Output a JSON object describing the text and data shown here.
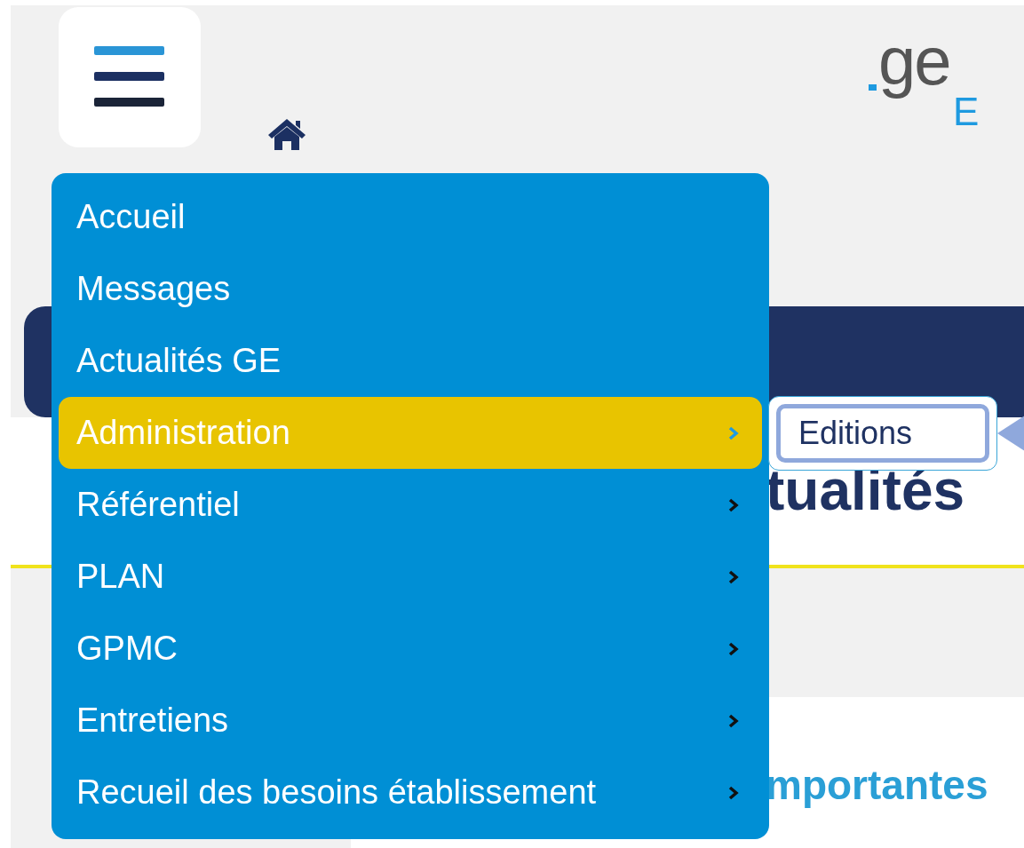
{
  "header": {
    "logo_text": "ge",
    "logo_subtext": "E"
  },
  "menu": {
    "items": [
      {
        "label": "Accueil",
        "has_submenu": false,
        "selected": false
      },
      {
        "label": "Messages",
        "has_submenu": false,
        "selected": false
      },
      {
        "label": "Actualités GE",
        "has_submenu": false,
        "selected": false
      },
      {
        "label": "Administration",
        "has_submenu": true,
        "selected": true
      },
      {
        "label": "Référentiel",
        "has_submenu": true,
        "selected": false
      },
      {
        "label": "PLAN",
        "has_submenu": true,
        "selected": false
      },
      {
        "label": "GPMC",
        "has_submenu": true,
        "selected": false
      },
      {
        "label": "Entretiens",
        "has_submenu": true,
        "selected": false
      },
      {
        "label": "Recueil des besoins établissement",
        "has_submenu": true,
        "selected": false
      }
    ]
  },
  "submenu": {
    "items": [
      {
        "label": "Editions",
        "selected": true
      }
    ]
  },
  "page": {
    "heading": "tualités",
    "subheading": "mportantes"
  }
}
